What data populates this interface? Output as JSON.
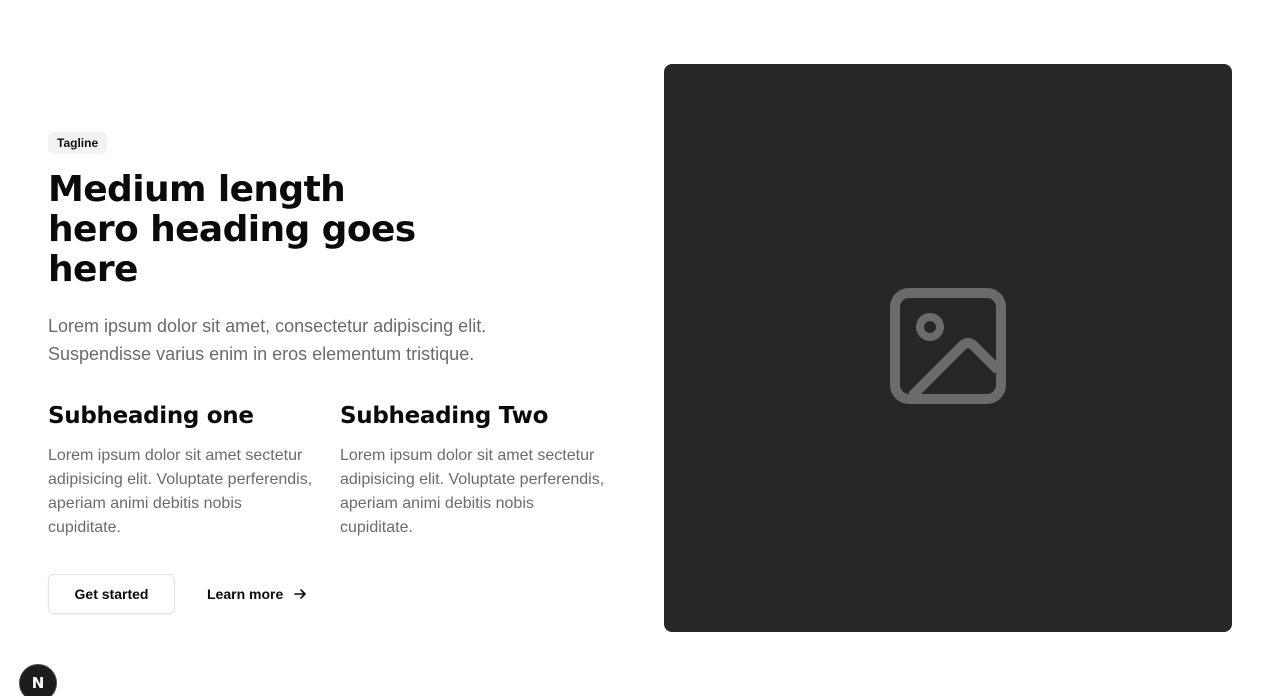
{
  "hero": {
    "tagline": "Tagline",
    "heading": "Medium length hero heading goes here",
    "description": "Lorem ipsum dolor sit amet, consectetur adipiscing elit. Suspendisse varius enim in eros elementum tristique.",
    "features": [
      {
        "title": "Subheading one",
        "text": "Lorem ipsum dolor sit amet sectetur adipisicing elit. Voluptate perferendis, aperiam animi debitis nobis cupiditate."
      },
      {
        "title": "Subheading Two",
        "text": "Lorem ipsum dolor sit amet sectetur adipisicing elit. Voluptate perferendis, aperiam animi debitis nobis cupiditate."
      }
    ],
    "primary_button": "Get started",
    "secondary_button": "Learn more",
    "secondary_icon": "arrow-right-icon",
    "image_icon": "image-placeholder-icon"
  },
  "dev_badge": {
    "label": "N",
    "icon": "nextjs-logo-icon"
  },
  "colors": {
    "text": "#0a0a0a",
    "muted": "#6b6b6b",
    "tagline_bg": "#f2f2f2",
    "media_bg": "#272727",
    "media_icon": "#6b6b6b"
  }
}
